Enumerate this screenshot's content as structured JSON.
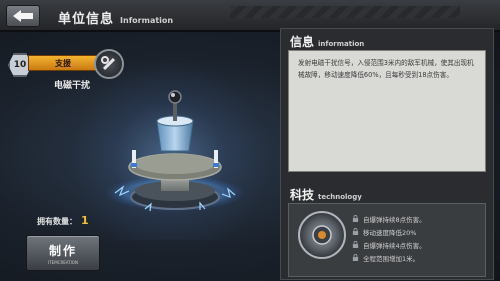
{
  "header": {
    "back_icon": "back-arrow-icon",
    "title_cn": "单位信息",
    "title_en": "Information"
  },
  "unit": {
    "level": "10",
    "category": "支援",
    "name": "电磁干扰",
    "quantity_label": "拥有数量：",
    "quantity": "1"
  },
  "make_button": {
    "label": "制作",
    "sub_label": "ITEMCREATION"
  },
  "info": {
    "title_cn": "信息",
    "title_en": "information",
    "description": "发射电磁干扰信号，入侵范围3米内的敌军机械，使其出现机械故障，移动速度降低60%，且每秒受到18点伤害。"
  },
  "technology": {
    "title_cn": "科技",
    "title_en": "technology",
    "items": [
      "自爆弹持续8点伤害。",
      "移动速度降低20%",
      "自爆弹持续4点伤害。",
      "全程范围增加1米。"
    ]
  },
  "colors": {
    "accent_orange": "#e9a22a",
    "quantity_yellow": "#f1c232",
    "panel_dark": "#2a2c2f",
    "info_paper": "#d9dad6"
  }
}
